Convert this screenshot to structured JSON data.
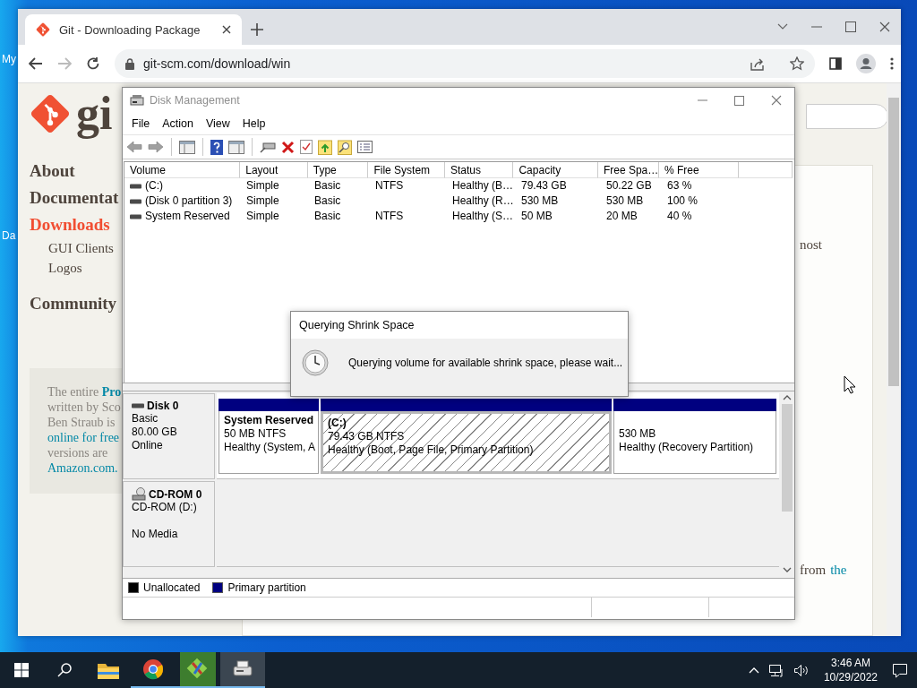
{
  "desktop": {
    "icon_labels": [
      "My",
      "Da"
    ]
  },
  "browser": {
    "tab": {
      "title": "Git - Downloading Package"
    },
    "url": "git-scm.com/download/win",
    "page": {
      "logo_text": "gi",
      "nav": [
        {
          "label": "About",
          "selected": false
        },
        {
          "label": "Documentat",
          "selected": false
        },
        {
          "label": "Downloads",
          "selected": true,
          "children": [
            {
              "label": "GUI Clients",
              "selected": false
            },
            {
              "label": "Logos",
              "selected": false
            }
          ]
        },
        {
          "label": "Community",
          "selected": false
        }
      ],
      "book_lines": [
        {
          "kind": "text",
          "text": "The entire **Pro**"
        },
        {
          "kind": "text",
          "text": "written by Sco"
        },
        {
          "kind": "text",
          "text": "Ben Straub is"
        },
        {
          "kind": "link",
          "text": "online for free"
        },
        {
          "kind": "text",
          "text": "versions are"
        },
        {
          "kind": "link",
          "text": "Amazon.com."
        }
      ],
      "fragments": [
        [
          {
            "kind": "text",
            "text": "nost"
          }
        ],
        [
          {
            "kind": "text",
            "text": "from"
          },
          {
            "kind": "link",
            "text": "the"
          }
        ]
      ]
    }
  },
  "disk_management": {
    "title": "Disk Management",
    "menu": [
      "File",
      "Action",
      "View",
      "Help"
    ],
    "columns": [
      "Volume",
      "Layout",
      "Type",
      "File System",
      "Status",
      "Capacity",
      "Free Spa…",
      "% Free"
    ],
    "volumes": [
      {
        "volume": "(C:)",
        "layout": "Simple",
        "type": "Basic",
        "file_system": "NTFS",
        "status": "Healthy (B…",
        "capacity": "79.43 GB",
        "free_space": "50.22 GB",
        "percent_free": "63 %"
      },
      {
        "volume": "(Disk 0 partition 3)",
        "layout": "Simple",
        "type": "Basic",
        "status": "Healthy (R…",
        "capacity": "530 MB",
        "free_space": "530 MB",
        "percent_free": "100 %"
      },
      {
        "volume": "System Reserved",
        "layout": "Simple",
        "type": "Basic",
        "file_system": "NTFS",
        "status": "Healthy (S…",
        "capacity": "50 MB",
        "free_space": "20 MB",
        "percent_free": "40 %"
      }
    ],
    "disks": [
      {
        "kind": "disk",
        "name": "Disk 0",
        "lines": [
          "Basic",
          "80.00 GB"
        ],
        "status": "Online",
        "partitions": [
          {
            "title": "System Reserved",
            "size": "50 MB NTFS",
            "status": "Healthy (System, A",
            "selected": false,
            "color": "#000080"
          },
          {
            "title": "(C:)",
            "size": "79.43 GB NTFS",
            "status": "Healthy (Boot, Page File, Primary Partition)",
            "selected": true,
            "color": "#000080"
          },
          {
            "size": "530 MB",
            "status": "Healthy (Recovery Partition)",
            "selected": false,
            "color": "#000080"
          }
        ]
      },
      {
        "kind": "cdrom",
        "name": "CD-ROM 0",
        "lines": [
          "CD-ROM (D:)"
        ],
        "status": "No Media"
      }
    ],
    "legend": [
      {
        "label": "Unallocated",
        "color": "#000000"
      },
      {
        "label": "Primary partition",
        "color": "#000080"
      }
    ],
    "dialog": {
      "title": "Querying Shrink Space",
      "message": "Querying volume for available shrink space, please wait..."
    }
  },
  "taskbar": {
    "apps": [
      {
        "kind": "explorer",
        "open": false,
        "selected": false
      },
      {
        "kind": "chrome",
        "open": true,
        "selected": false
      },
      {
        "kind": "git",
        "open": true,
        "selected": false
      },
      {
        "kind": "disk",
        "open": true,
        "selected": true
      }
    ],
    "time": "3:46 AM",
    "date": "10/29/2022"
  }
}
